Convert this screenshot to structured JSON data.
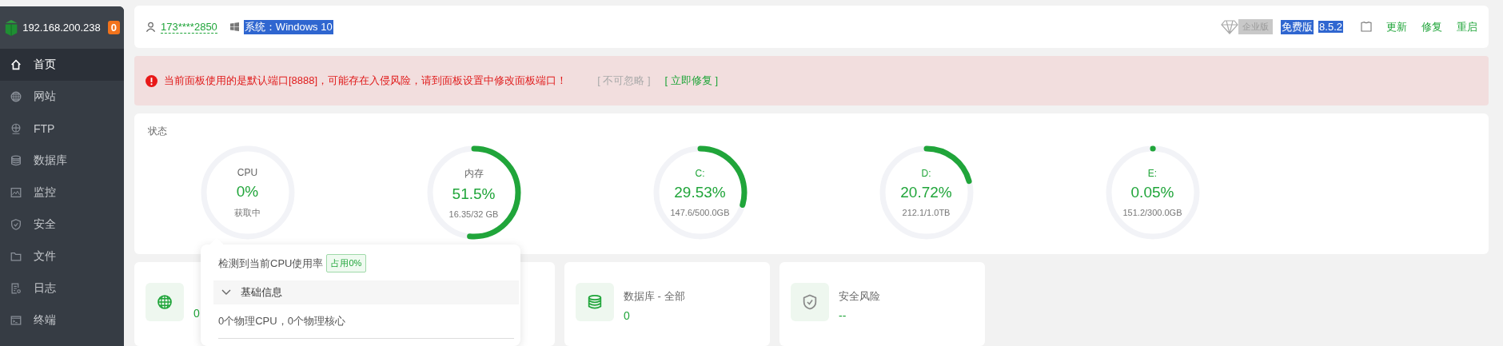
{
  "sidebar": {
    "host": "192.168.200.238",
    "badge": "0",
    "items": [
      {
        "label": "首页",
        "selected": true
      },
      {
        "label": "网站",
        "selected": false
      },
      {
        "label": "FTP",
        "selected": false
      },
      {
        "label": "数据库",
        "selected": false
      },
      {
        "label": "监控",
        "selected": false
      },
      {
        "label": "安全",
        "selected": false
      },
      {
        "label": "文件",
        "selected": false
      },
      {
        "label": "日志",
        "selected": false
      },
      {
        "label": "终端",
        "selected": false
      }
    ]
  },
  "topbar": {
    "user": "173****2850",
    "system": {
      "text": "系统：Windows 10",
      "highlighted": true
    },
    "edition": "企业版",
    "free": {
      "text": "免费版",
      "highlighted": true
    },
    "version": {
      "text": "8.5.2",
      "highlighted": true
    },
    "links": [
      "更新",
      "修复",
      "重启"
    ]
  },
  "alert": {
    "message": "当前面板使用的是默认端口[8888]，可能存在入侵风险，请到面板设置中修改面板端口！",
    "ignore": "[ 不可忽略 ]",
    "fix": "[ 立即修复 ]"
  },
  "status": {
    "title": "状态",
    "gauges": [
      {
        "kind": "cpu",
        "label": "CPU",
        "value": "0%",
        "detail": "获取中",
        "level": 0
      },
      {
        "kind": "memory",
        "label": "内存",
        "value": "51.5%",
        "detail": "16.35/32 GB",
        "level": 0.515
      },
      {
        "kind": "disk",
        "label": "C:",
        "value": "29.53%",
        "detail": "147.6/500.0GB",
        "level": 0.2953
      },
      {
        "kind": "disk",
        "label": "D:",
        "value": "20.72%",
        "detail": "212.1/1.0TB",
        "level": 0.2072
      },
      {
        "kind": "disk",
        "label": "E:",
        "value": "0.05%",
        "detail": "151.2/300.0GB",
        "level": 0.0005
      }
    ]
  },
  "cards": [
    {
      "value": "0"
    },
    {
      "title": "数据库 - 全部",
      "value": "0"
    },
    {
      "title": "安全风险",
      "value": "--"
    }
  ],
  "popover": {
    "heading": "检测到当前CPU使用率",
    "usage": "占用0%",
    "section": {
      "title": "基础信息",
      "expanded": true
    },
    "info": "0个物理CPU，0个物理核心"
  }
}
